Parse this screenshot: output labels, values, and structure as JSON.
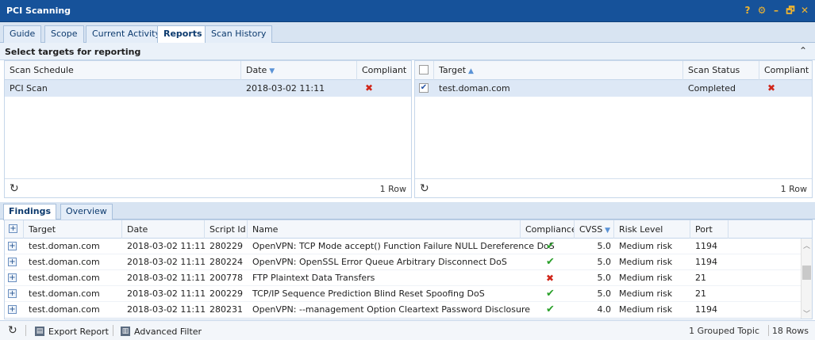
{
  "app": {
    "title": "PCI Scanning",
    "controls": [
      "?",
      "⚙",
      "–",
      "🗗",
      "✕"
    ]
  },
  "tabs": [
    {
      "label": "Guide",
      "active": false
    },
    {
      "label": "Scope",
      "active": false
    },
    {
      "label": "Current Activity",
      "active": false
    },
    {
      "label": "Reports",
      "active": true
    },
    {
      "label": "Scan History",
      "active": false
    }
  ],
  "section": {
    "title": "Select targets for reporting"
  },
  "schedule_panel": {
    "columns": [
      "Scan Schedule",
      "Date",
      "Compliant"
    ],
    "sorted_column": "Date",
    "sort_dir": "desc",
    "rows": [
      {
        "schedule": "PCI Scan",
        "date": "2018-03-02 11:11",
        "compliant": false
      }
    ],
    "row_count": "1 Row"
  },
  "target_panel": {
    "columns": [
      "Target",
      "Scan Status",
      "Compliant"
    ],
    "sorted_column": "Target",
    "sort_dir": "asc",
    "rows": [
      {
        "checked": true,
        "target": "test.doman.com",
        "status": "Completed",
        "compliant": false
      }
    ],
    "row_count": "1 Row"
  },
  "bottom_tabs": [
    {
      "label": "Findings",
      "active": true
    },
    {
      "label": "Overview",
      "active": false
    }
  ],
  "findings": {
    "columns": [
      "Target",
      "Date",
      "Script Id",
      "Name",
      "Compliance S",
      "CVSS",
      "Risk Level",
      "Port"
    ],
    "sorted_column": "CVSS",
    "rows": [
      {
        "target": "test.doman.com",
        "date": "2018-03-02 11:11",
        "script_id": "280229",
        "name": "OpenVPN: TCP Mode accept() Function Failure NULL Dereference DoS",
        "compliant": true,
        "cvss": "5.0",
        "risk": "Medium risk",
        "port": "1194"
      },
      {
        "target": "test.doman.com",
        "date": "2018-03-02 11:11",
        "script_id": "280224",
        "name": "OpenVPN: OpenSSL Error Queue Arbitrary Disconnect DoS",
        "compliant": true,
        "cvss": "5.0",
        "risk": "Medium risk",
        "port": "1194"
      },
      {
        "target": "test.doman.com",
        "date": "2018-03-02 11:11",
        "script_id": "200778",
        "name": "FTP Plaintext Data Transfers",
        "compliant": false,
        "cvss": "5.0",
        "risk": "Medium risk",
        "port": "21"
      },
      {
        "target": "test.doman.com",
        "date": "2018-03-02 11:11",
        "script_id": "200229",
        "name": "TCP/IP Sequence Prediction Blind Reset Spoofing DoS",
        "compliant": true,
        "cvss": "5.0",
        "risk": "Medium risk",
        "port": "21"
      },
      {
        "target": "test.doman.com",
        "date": "2018-03-02 11:11",
        "script_id": "280231",
        "name": "OpenVPN: --management Option Cleartext Password Disclosure",
        "compliant": true,
        "cvss": "4.0",
        "risk": "Medium risk",
        "port": "1194"
      }
    ]
  },
  "statusbar": {
    "export_label": "Export Report",
    "filter_label": "Advanced Filter",
    "grouped": "1 Grouped Topic",
    "rows": "18 Rows"
  },
  "colors": {
    "titlebar": "#16529a",
    "accent": "#f0b430",
    "selected_row": "#dde8f6",
    "fail": "#d0261a",
    "pass": "#2aa02a"
  }
}
